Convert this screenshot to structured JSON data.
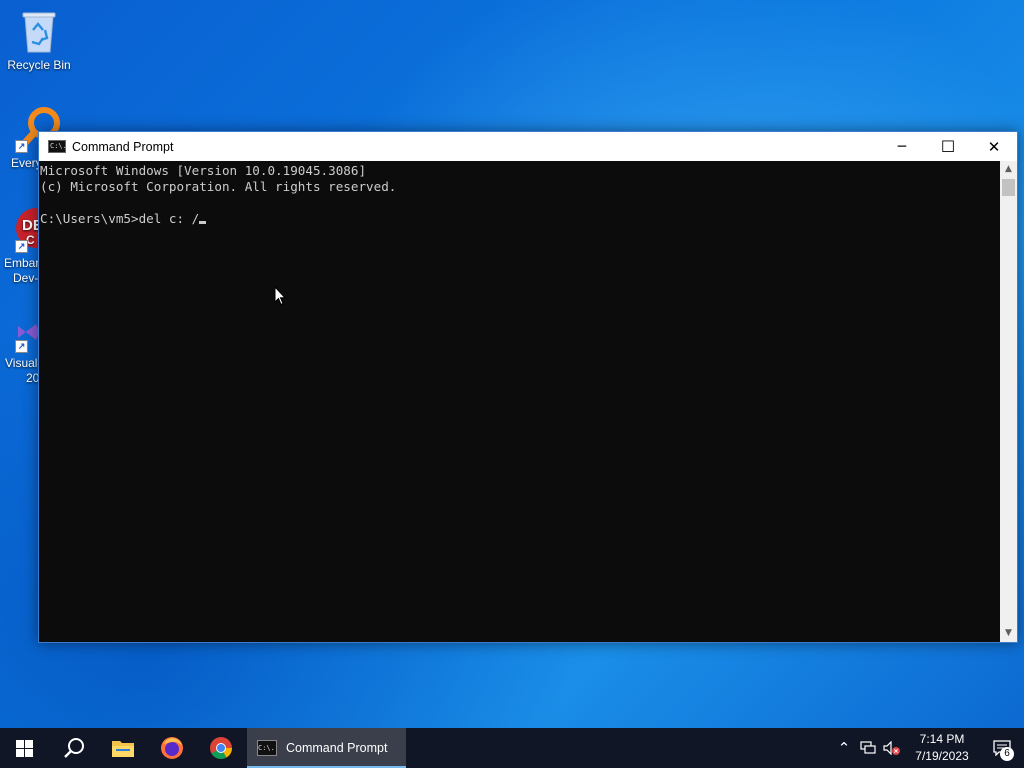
{
  "desktop": {
    "icons": [
      {
        "label": "Recycle Bin",
        "icon": "recycle-bin-icon"
      },
      {
        "label": "Every",
        "icon": "everything-search-icon"
      },
      {
        "label": "Embar",
        "label2": "Dev-",
        "icon": "embarcadero-dev-cpp-icon"
      },
      {
        "label": "Visual",
        "label2": "20",
        "icon": "visual-studio-icon"
      }
    ]
  },
  "window": {
    "title": "Command Prompt",
    "icon": "cmd-icon",
    "icon_text": "C:\\.",
    "controls": {
      "minimize": "─",
      "maximize": "☐",
      "close": "✕"
    }
  },
  "console": {
    "lines": [
      "Microsoft Windows [Version 10.0.19045.3086]",
      "(c) Microsoft Corporation. All rights reserved.",
      "",
      "C:\\Users\\vm5>del c: /"
    ]
  },
  "scrollbar": {
    "up": "▲",
    "down": "▼"
  },
  "taskbar": {
    "pinned": [
      {
        "name": "start-button",
        "icon": "windows-logo-icon"
      },
      {
        "name": "search-button",
        "icon": "search-icon"
      },
      {
        "name": "file-explorer-button",
        "icon": "folder-icon"
      },
      {
        "name": "firefox-button",
        "icon": "firefox-icon"
      },
      {
        "name": "chrome-button",
        "icon": "chrome-icon"
      }
    ],
    "active_app": {
      "label": "Command Prompt",
      "icon_text": "C:\\."
    },
    "tray": {
      "icons": [
        "chevron-up-icon",
        "network-icon",
        "volume-muted-icon"
      ],
      "chevron": "⌃",
      "time": "7:14 PM",
      "date": "7/19/2023",
      "notifications_count": "6"
    }
  },
  "colors": {
    "console_bg": "#0c0c0c",
    "console_text": "#cccccc",
    "taskbar_bg": "#101626",
    "active_app_accent": "#76b9ed"
  }
}
